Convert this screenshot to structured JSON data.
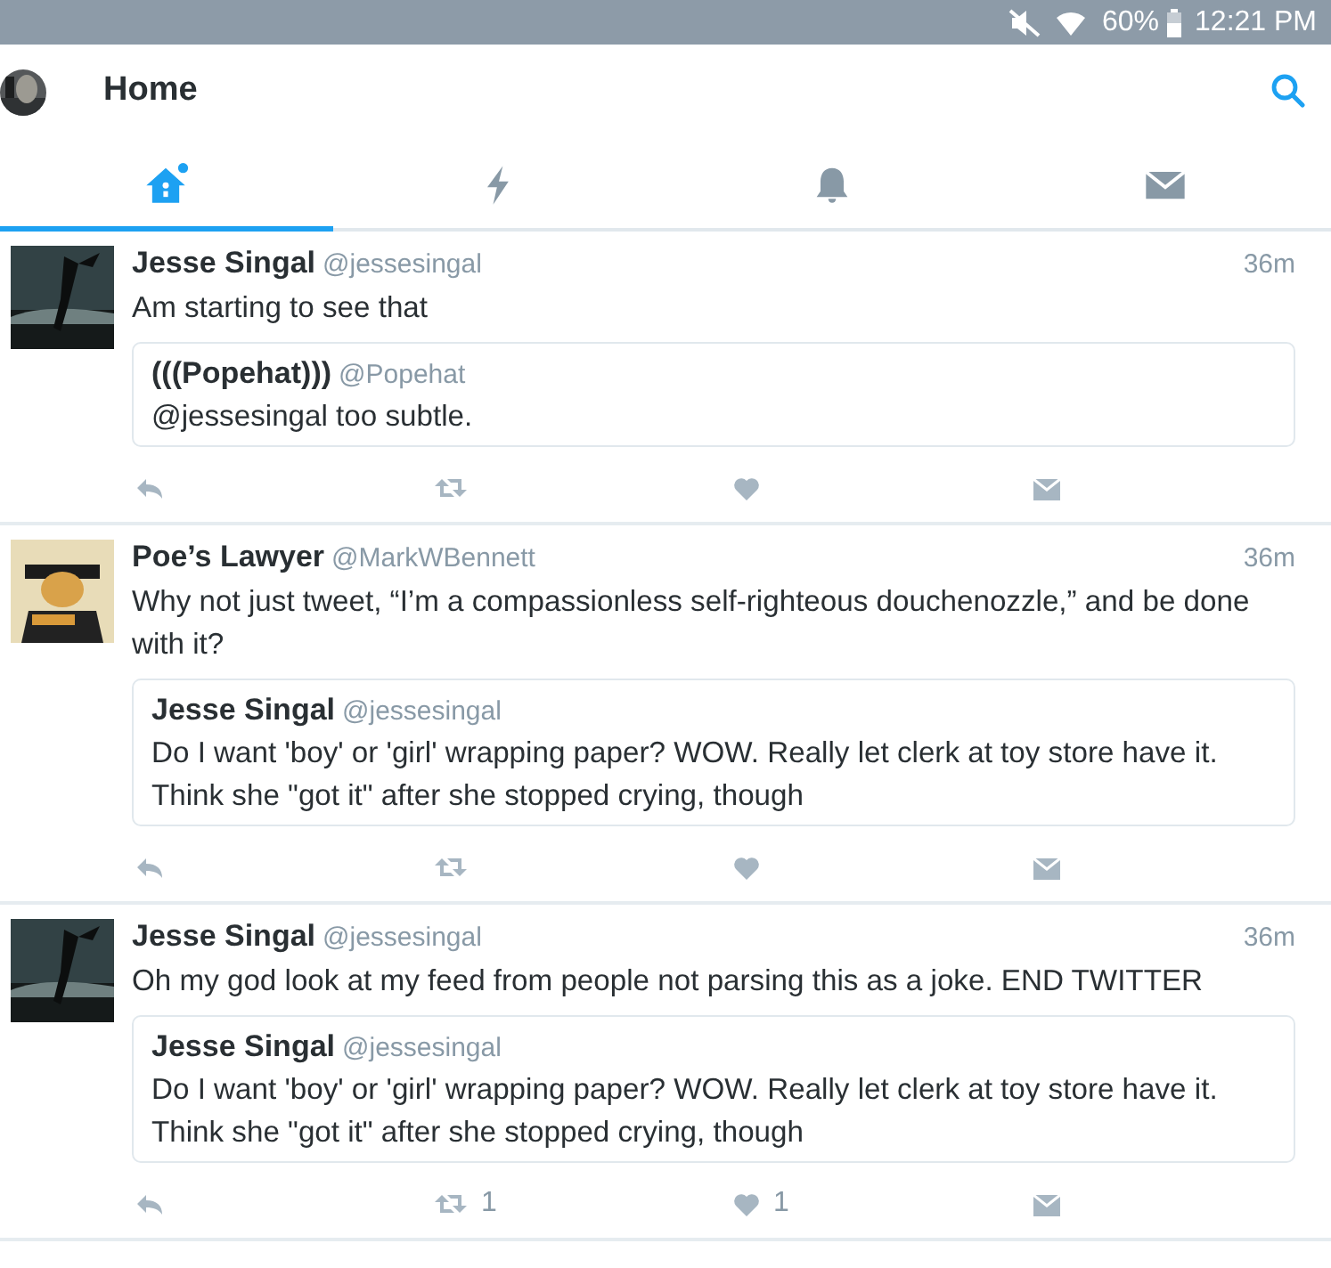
{
  "status_bar": {
    "battery_text": "60%",
    "time": "12:21 PM"
  },
  "header": {
    "title": "Home"
  },
  "tabs": [
    {
      "kind": "home",
      "selected": true,
      "new_dot": true
    },
    {
      "kind": "moments",
      "selected": false,
      "new_dot": false
    },
    {
      "kind": "notifications",
      "selected": false,
      "new_dot": false
    },
    {
      "kind": "messages",
      "selected": false,
      "new_dot": false
    }
  ],
  "tweets": [
    {
      "name": "Jesse Singal",
      "handle": "@jessesingal",
      "time": "36m",
      "text": "Am starting to see that",
      "quote": {
        "name": "(((Popehat)))",
        "handle": "@Popehat",
        "text": "@jessesingal too subtle."
      }
    },
    {
      "name": "Poe’s Lawyer",
      "handle": "@MarkWBennett",
      "time": "36m",
      "text": "Why not just tweet, “I’m a compassionless self-righteous douchenozzle,” and be done with it?",
      "quote": {
        "name": "Jesse Singal",
        "handle": "@jessesingal",
        "text": "Do I want 'boy' or 'girl' wrapping paper? WOW. Really let clerk at toy store have it. Think she \"got it\" after she stopped crying, though"
      }
    },
    {
      "name": "Jesse Singal",
      "handle": "@jessesingal",
      "time": "36m",
      "text": "Oh my god look at my feed from people not parsing this as a joke. END TWITTER",
      "quote": {
        "name": "Jesse Singal",
        "handle": "@jessesingal",
        "text": "Do I want 'boy' or 'girl' wrapping paper? WOW. Really let clerk at toy store have it. Think she \"got it\" after she stopped crying, though"
      },
      "retweet_count": "1",
      "like_count": "1"
    }
  ]
}
